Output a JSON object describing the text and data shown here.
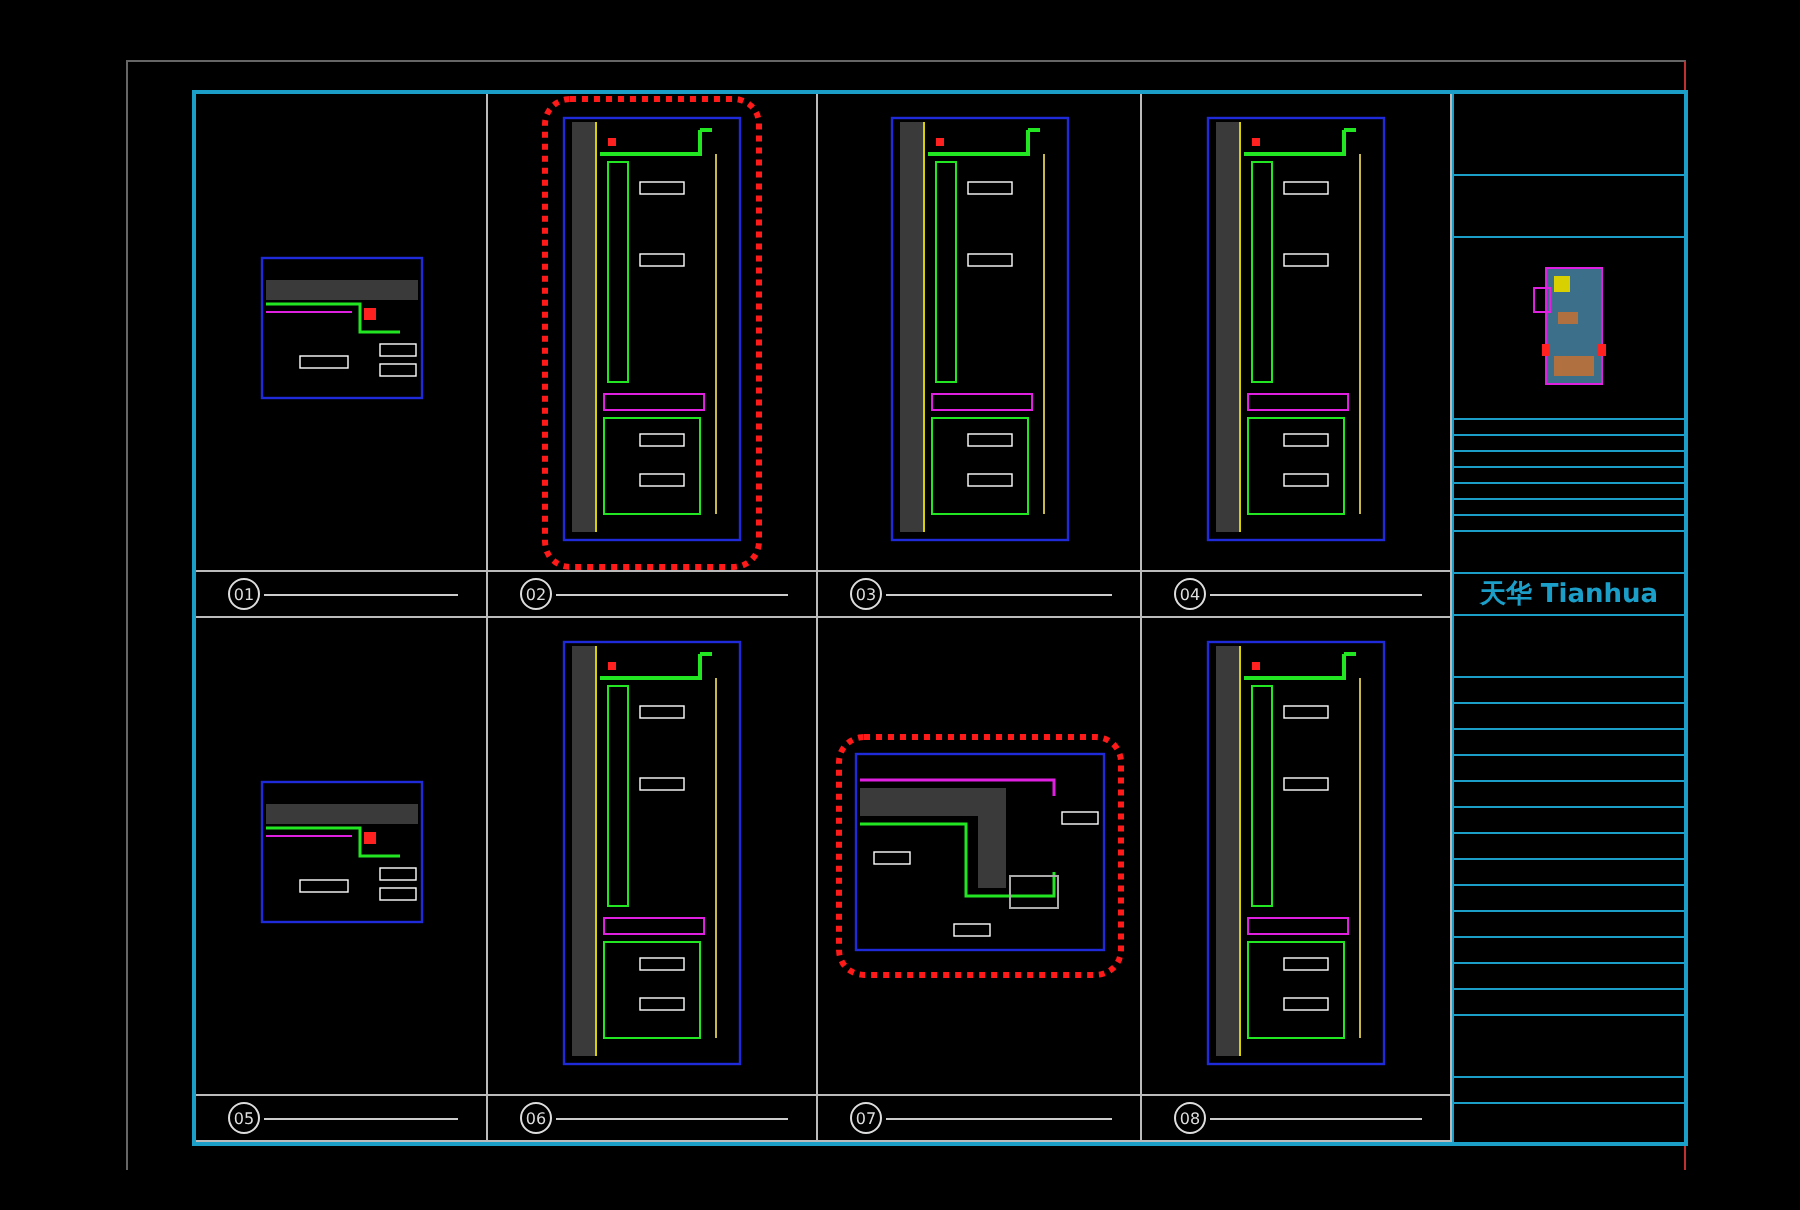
{
  "panels": [
    {
      "number": "01",
      "kind": "small",
      "revision_cloud": false
    },
    {
      "number": "02",
      "kind": "tall",
      "revision_cloud": true
    },
    {
      "number": "03",
      "kind": "tall",
      "revision_cloud": false
    },
    {
      "number": "04",
      "kind": "tall",
      "revision_cloud": false
    },
    {
      "number": "05",
      "kind": "small",
      "revision_cloud": false
    },
    {
      "number": "06",
      "kind": "tall",
      "revision_cloud": false
    },
    {
      "number": "07",
      "kind": "corner",
      "revision_cloud": true
    },
    {
      "number": "08",
      "kind": "tall",
      "revision_cloud": false
    }
  ],
  "title_block": {
    "logo": "天华 Tianhua"
  }
}
